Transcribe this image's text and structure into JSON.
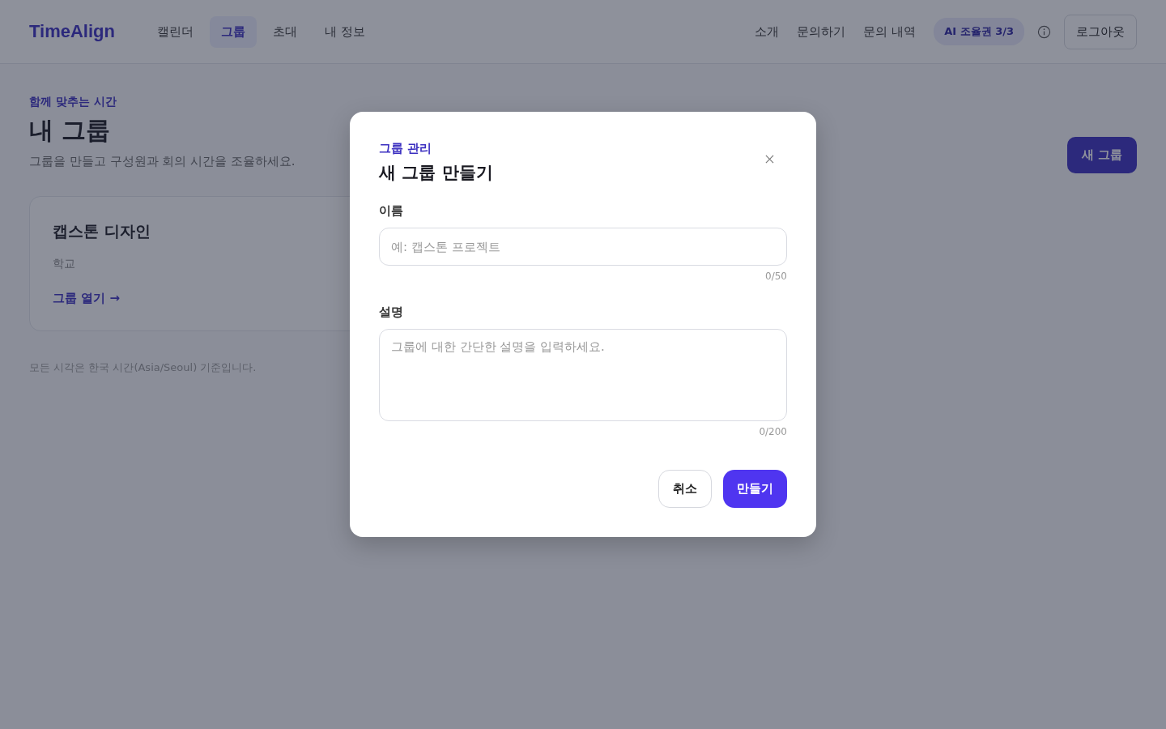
{
  "header": {
    "logo": "TimeAlign",
    "nav": [
      {
        "label": "캘린더",
        "selected": false
      },
      {
        "label": "그룹",
        "selected": true
      },
      {
        "label": "초대",
        "selected": false
      },
      {
        "label": "내 정보",
        "selected": false
      }
    ],
    "links": [
      "소개",
      "문의하기",
      "문의 내역"
    ],
    "ai_badge": "AI 조율권 3/3",
    "logout": "로그아웃"
  },
  "page": {
    "eyebrow": "함께 맞추는 시간",
    "title": "내 그룹",
    "subtitle": "그룹을 만들고 구성원과 회의 시간을 조율하세요.",
    "new_button": "새 그룹",
    "groups": [
      {
        "name": "캡스톤 디자인",
        "category": "학교",
        "open_link": "그룹 열기 →"
      }
    ],
    "footnote": "모든 시각은 한국 시간(Asia/Seoul) 기준입니다."
  },
  "dialog": {
    "eyebrow": "그룹 관리",
    "title": "새 그룹 만들기",
    "fields": [
      {
        "kind": "input",
        "label": "이름",
        "placeholder": "예: 캡스톤 프로젝트",
        "counter": "0/50"
      },
      {
        "kind": "textarea",
        "label": "설명",
        "placeholder": "그룹에 대한 간단한 설명을 입력하세요.",
        "counter": "0/200"
      }
    ],
    "buttons": [
      {
        "kind": "secondary",
        "label": "취소"
      },
      {
        "kind": "primary",
        "label": "만들기"
      }
    ]
  }
}
